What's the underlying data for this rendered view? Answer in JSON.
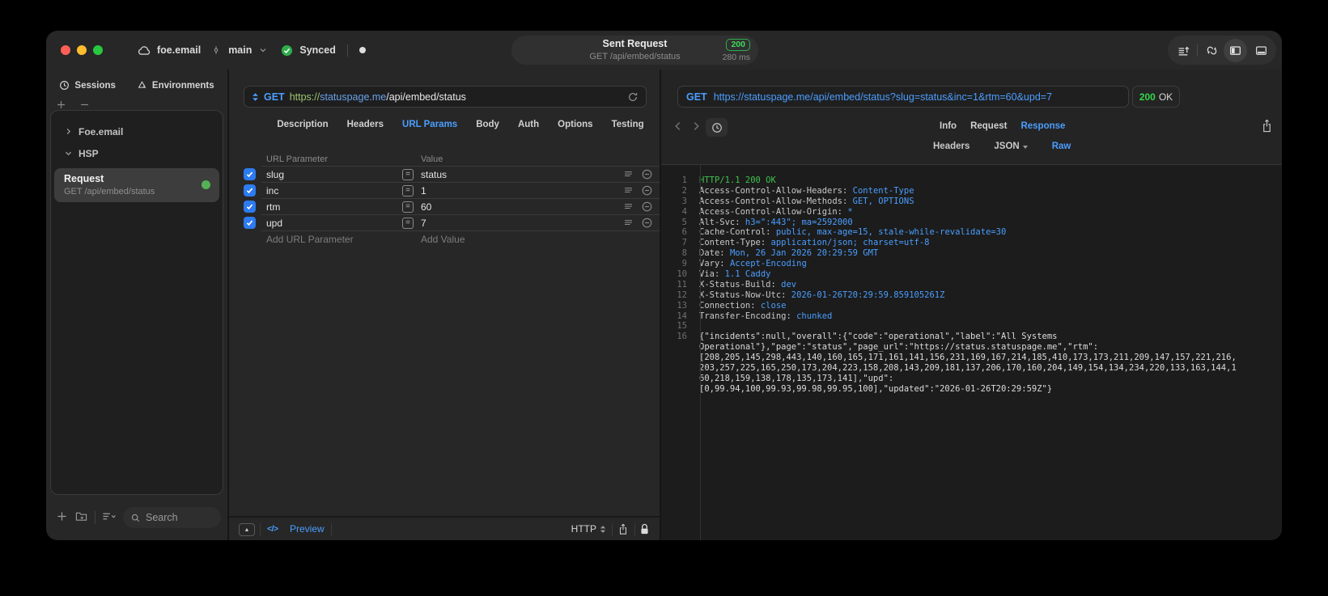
{
  "titlebar": {
    "project": "foe.email",
    "branch": "main",
    "sync_label": "Synced",
    "request_summary": {
      "title": "Sent Request",
      "method_path": "GET /api/embed/status",
      "status_code": "200",
      "duration": "280 ms"
    }
  },
  "sidebar": {
    "tabs": [
      {
        "label": "Sessions"
      },
      {
        "label": "Environments"
      }
    ],
    "tree": [
      {
        "label": "Foe.email"
      },
      {
        "label": "HSP"
      }
    ],
    "request_item": {
      "title": "Request",
      "subtitle": "GET /api/embed/status"
    },
    "search_placeholder": "Search"
  },
  "request_editor": {
    "method": "GET",
    "url": {
      "scheme": "https://",
      "host": "statuspage.me",
      "path": "/api/embed/status"
    },
    "tabs": [
      "Description",
      "Headers",
      "URL Params",
      "Body",
      "Auth",
      "Options",
      "Testing"
    ],
    "active_tab": "URL Params",
    "params": {
      "columns": {
        "name": "URL Parameter",
        "value": "Value"
      },
      "rows": [
        {
          "name": "slug",
          "value": "status",
          "enabled": true
        },
        {
          "name": "inc",
          "value": "1",
          "enabled": true
        },
        {
          "name": "rtm",
          "value": "60",
          "enabled": true
        },
        {
          "name": "upd",
          "value": "7",
          "enabled": true
        }
      ],
      "add_name_placeholder": "Add URL Parameter",
      "add_value_placeholder": "Add Value"
    },
    "footer": {
      "preview_label": "Preview",
      "protocol": "HTTP",
      "code_glyph": "</>"
    }
  },
  "response_viewer": {
    "method": "GET",
    "url": "https://statuspage.me/api/embed/status?slug=status&inc=1&rtm=60&upd=7",
    "status_code": "200",
    "status_text": "OK",
    "tabs": [
      "Info",
      "Request",
      "Response"
    ],
    "active_tab": "Response",
    "subtabs": [
      "Headers",
      "JSON",
      "Raw"
    ],
    "active_subtab": "Raw",
    "code_lines": [
      {
        "n": "1",
        "parts": [
          {
            "t": "HTTP/1.1 200 OK",
            "c": "green"
          }
        ]
      },
      {
        "n": "2",
        "parts": [
          {
            "t": "Access-Control-Allow-Headers: ",
            "c": "key"
          },
          {
            "t": "Content-Type",
            "c": "val"
          }
        ]
      },
      {
        "n": "3",
        "parts": [
          {
            "t": "Access-Control-Allow-Methods: ",
            "c": "key"
          },
          {
            "t": "GET, OPTIONS",
            "c": "val"
          }
        ]
      },
      {
        "n": "4",
        "parts": [
          {
            "t": "Access-Control-Allow-Origin: ",
            "c": "key"
          },
          {
            "t": "*",
            "c": "val"
          }
        ]
      },
      {
        "n": "5",
        "parts": [
          {
            "t": "Alt-Svc: ",
            "c": "key"
          },
          {
            "t": "h3=\":443\"; ma=2592000",
            "c": "val"
          }
        ]
      },
      {
        "n": "6",
        "parts": [
          {
            "t": "Cache-Control: ",
            "c": "key"
          },
          {
            "t": "public, max-age=15, stale-while-revalidate=30",
            "c": "val"
          }
        ]
      },
      {
        "n": "7",
        "parts": [
          {
            "t": "Content-Type: ",
            "c": "key"
          },
          {
            "t": "application/json; charset=utf-8",
            "c": "val"
          }
        ]
      },
      {
        "n": "8",
        "parts": [
          {
            "t": "Date: ",
            "c": "key"
          },
          {
            "t": "Mon, 26 Jan 2026 20:29:59 GMT",
            "c": "val"
          }
        ]
      },
      {
        "n": "9",
        "parts": [
          {
            "t": "Vary: ",
            "c": "key"
          },
          {
            "t": "Accept-Encoding",
            "c": "val"
          }
        ]
      },
      {
        "n": "10",
        "parts": [
          {
            "t": "Via: ",
            "c": "key"
          },
          {
            "t": "1.1 Caddy",
            "c": "val"
          }
        ]
      },
      {
        "n": "11",
        "parts": [
          {
            "t": "X-Status-Build: ",
            "c": "key"
          },
          {
            "t": "dev",
            "c": "val"
          }
        ]
      },
      {
        "n": "12",
        "parts": [
          {
            "t": "X-Status-Now-Utc: ",
            "c": "key"
          },
          {
            "t": "2026-01-26T20:29:59.859105261Z",
            "c": "val"
          }
        ]
      },
      {
        "n": "13",
        "parts": [
          {
            "t": "Connection: ",
            "c": "key"
          },
          {
            "t": "close",
            "c": "val"
          }
        ]
      },
      {
        "n": "14",
        "parts": [
          {
            "t": "Transfer-Encoding: ",
            "c": "key"
          },
          {
            "t": "chunked",
            "c": "val"
          }
        ]
      },
      {
        "n": "15",
        "parts": []
      },
      {
        "n": "16",
        "parts": [
          {
            "t": "{\"incidents\":null,\"overall\":{\"code\":\"operational\",\"label\":\"All Systems",
            "c": "plain"
          }
        ]
      },
      {
        "n": "",
        "parts": [
          {
            "t": "Operational\"},\"page\":\"status\",\"page_url\":\"https://status.statuspage.me\",\"rtm\":",
            "c": "plain"
          }
        ]
      },
      {
        "n": "",
        "parts": [
          {
            "t": "[208,205,145,298,443,140,160,165,171,161,141,156,231,169,167,214,185,410,173,173,211,209,147,157,221,216,",
            "c": "plain"
          }
        ]
      },
      {
        "n": "",
        "parts": [
          {
            "t": "203,257,225,165,250,173,204,223,158,208,143,209,181,137,206,170,160,204,149,154,134,234,220,133,163,144,1",
            "c": "plain"
          }
        ]
      },
      {
        "n": "",
        "parts": [
          {
            "t": "60,218,159,138,178,135,173,141],\"upd\":",
            "c": "plain"
          }
        ]
      },
      {
        "n": "",
        "parts": [
          {
            "t": "[0,99.94,100,99.93,99.98,99.95,100],\"updated\":\"2026-01-26T20:29:59Z\"}",
            "c": "plain"
          }
        ]
      }
    ]
  },
  "colors": {
    "accent_blue": "#4b9eff",
    "success_green": "#32d74b",
    "checkbox_blue": "#2d7bf0"
  }
}
